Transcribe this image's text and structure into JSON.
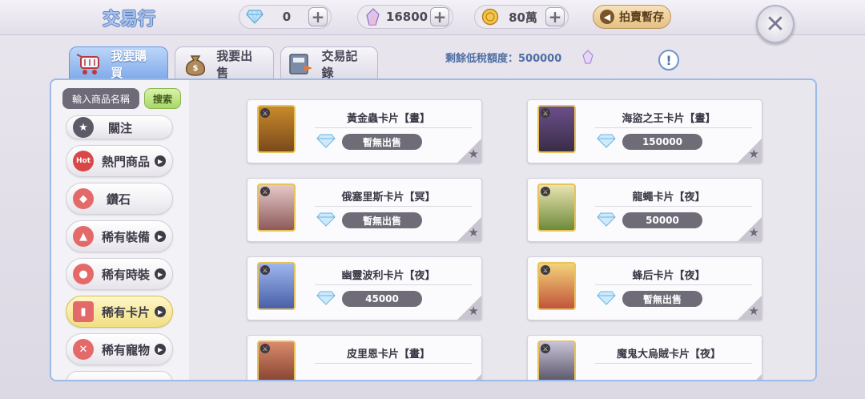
{
  "header": {
    "title": "交易行",
    "currencies": [
      {
        "icon": "diamond-icon",
        "value": "0"
      },
      {
        "icon": "crystal-icon",
        "value": "16800"
      },
      {
        "icon": "zeny-coin-icon",
        "value": "80萬"
      }
    ],
    "stash_label": "拍賣暫存"
  },
  "tabs": [
    {
      "label": "我要購買",
      "icon": "shopping-cart-icon",
      "active": true
    },
    {
      "label": "我要出售",
      "icon": "money-bag-icon",
      "active": false
    },
    {
      "label": "交易記錄",
      "icon": "record-book-icon",
      "active": false
    }
  ],
  "tax": {
    "label": "剩餘低稅額度：500000"
  },
  "search": {
    "placeholder": "輸入商品名稱",
    "button_label": "搜索"
  },
  "categories": [
    {
      "label": "關注",
      "icon": "star-icon",
      "active": false
    },
    {
      "label": "熱門商品",
      "icon": "hot-icon",
      "active": false
    },
    {
      "label": "鑽石",
      "icon": "diamond-icon",
      "active": false
    },
    {
      "label": "稀有裝備",
      "icon": "armor-icon",
      "active": false
    },
    {
      "label": "稀有時裝",
      "icon": "costume-icon",
      "active": false
    },
    {
      "label": "稀有卡片",
      "icon": "card-icon",
      "active": true
    },
    {
      "label": "稀有寵物",
      "icon": "bone-icon",
      "active": false
    }
  ],
  "items": [
    {
      "name": "黃金蟲卡片【晝】",
      "price": "暫無出售"
    },
    {
      "name": "海盜之王卡片【晝】",
      "price": "150000"
    },
    {
      "name": "俄塞里斯卡片【冥】",
      "price": "暫無出售"
    },
    {
      "name": "龍蠅卡片【夜】",
      "price": "50000"
    },
    {
      "name": "幽靈波利卡片【夜】",
      "price": "45000"
    },
    {
      "name": "蜂后卡片【夜】",
      "price": "暫無出售"
    },
    {
      "name": "皮里恩卡片【晝】",
      "price": ""
    },
    {
      "name": "魔鬼大烏賊卡片【夜】",
      "price": ""
    }
  ],
  "colors": {
    "accent": "#7fa9e8",
    "active_category": "#f1df83",
    "search_button": "#a9d76a"
  }
}
